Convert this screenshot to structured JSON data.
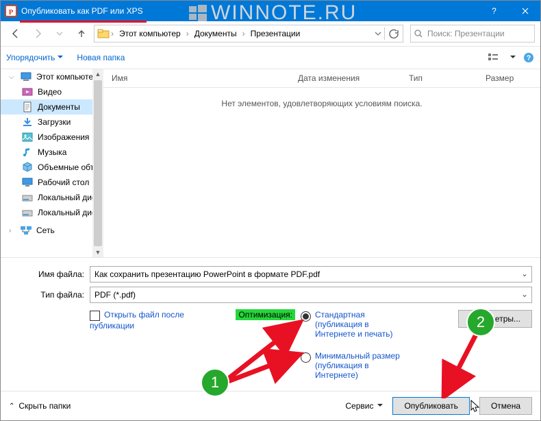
{
  "titlebar": {
    "title": "Опубликовать как PDF или XPS",
    "help": "?"
  },
  "watermark": "WINNOTE.RU",
  "breadcrumbs": [
    "Этот компьютер",
    "Документы",
    "Презентации"
  ],
  "search": {
    "placeholder": "Поиск: Презентации"
  },
  "toolbar": {
    "organize": "Упорядочить",
    "newfolder": "Новая папка"
  },
  "tree": {
    "computer": "Этот компьютер",
    "items": [
      "Видео",
      "Документы",
      "Загрузки",
      "Изображения",
      "Музыка",
      "Объемные объ",
      "Рабочий стол",
      "Локальный дис",
      "Локальный дис"
    ],
    "network": "Сеть"
  },
  "columns": [
    "Имя",
    "Дата изменения",
    "Тип",
    "Размер"
  ],
  "empty_msg": "Нет элементов, удовлетворяющих условиям поиска.",
  "form": {
    "filename_label": "Имя файла:",
    "filename": "Как сохранить презентацию PowerPoint в формате PDF.pdf",
    "filetype_label": "Тип файла:",
    "filetype": "PDF (*.pdf)",
    "open_after": "Открыть файл после публикации",
    "optimize_label": "Оптимизация:",
    "radio_standard": "Стандартная (публикация в Интернете и печать)",
    "radio_minimum": "Минимальный размер (публикация в Интернете)",
    "options_btn": "Параметры..."
  },
  "footer": {
    "hide_folders": "Скрыть папки",
    "tools": "Сервис",
    "publish": "Опубликовать",
    "cancel": "Отмена"
  },
  "annotations": [
    "1",
    "2"
  ]
}
